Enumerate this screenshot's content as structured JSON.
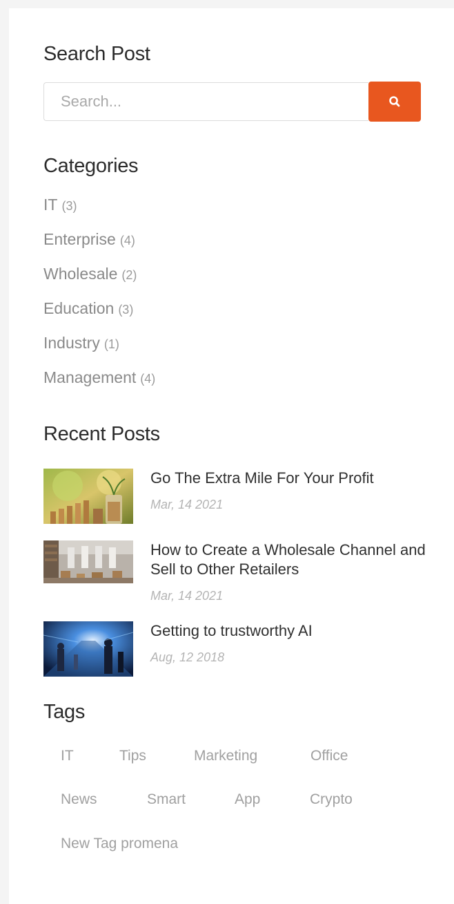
{
  "search": {
    "title": "Search Post",
    "placeholder": "Search...",
    "button_icon": "search-icon",
    "button_color": "#e8571f"
  },
  "categories": {
    "title": "Categories",
    "items": [
      {
        "name": "IT",
        "count": "(3)"
      },
      {
        "name": "Enterprise",
        "count": "(4)"
      },
      {
        "name": "Wholesale",
        "count": "(2)"
      },
      {
        "name": "Education",
        "count": "(3)"
      },
      {
        "name": "Industry",
        "count": "(1)"
      },
      {
        "name": "Management",
        "count": "(4)"
      }
    ]
  },
  "recent_posts": {
    "title": "Recent Posts",
    "items": [
      {
        "title": "Go The Extra Mile For Your Profit",
        "date": "Mar, 14 2021"
      },
      {
        "title": "How to Create a Wholesale Channel and Sell to Other Retailers",
        "date": "Mar, 14 2021"
      },
      {
        "title": "Getting to trustworthy AI",
        "date": "Aug, 12 2018"
      }
    ]
  },
  "tags": {
    "title": "Tags",
    "items": [
      "IT",
      "Tips",
      "Marketing",
      "Office",
      "News",
      "Smart",
      "App",
      "Crypto",
      "New Tag promena"
    ]
  }
}
